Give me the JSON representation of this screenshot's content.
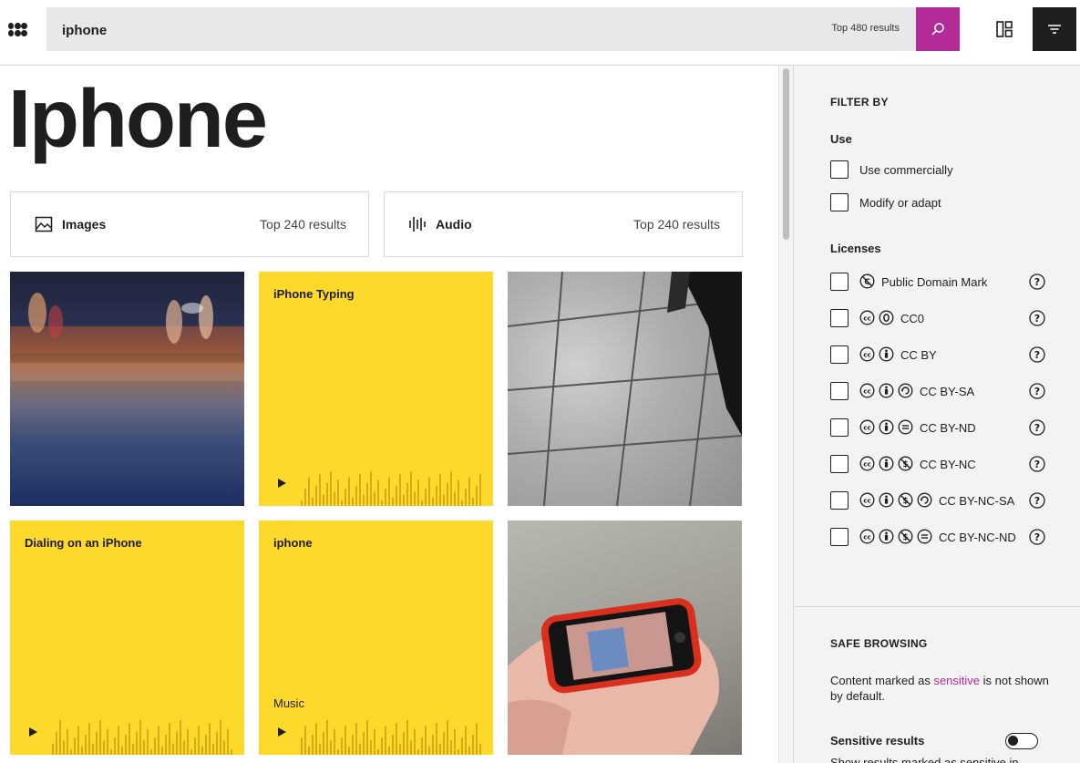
{
  "header": {
    "search_value": "iphone",
    "result_count": "Top 480 results",
    "icons": {
      "logo": "openverse-logo",
      "search": "search-icon",
      "layout": "layout-icon",
      "filter": "filter-icon"
    },
    "colors": {
      "accent": "#b42a97",
      "filter_button": "#1e1e1e"
    }
  },
  "main": {
    "title": "Iphone",
    "type_cards": [
      {
        "label": "Images",
        "count": "Top 240 results",
        "icon": "image-icon"
      },
      {
        "label": "Audio",
        "count": "Top 240 results",
        "icon": "audio-wave-icon"
      }
    ],
    "results": [
      {
        "kind": "image"
      },
      {
        "kind": "audio",
        "title": "iPhone Typing",
        "genre": ""
      },
      {
        "kind": "image"
      },
      {
        "kind": "audio",
        "title": "Dialing on an iPhone",
        "genre": ""
      },
      {
        "kind": "audio",
        "title": "iphone",
        "genre": "Music"
      },
      {
        "kind": "image"
      }
    ],
    "audio_tile_color": "#fcd92b"
  },
  "sidebar": {
    "filter_heading": "FILTER BY",
    "use": {
      "heading": "Use",
      "options": [
        "Use commercially",
        "Modify or adapt"
      ]
    },
    "licenses": {
      "heading": "Licenses",
      "items": [
        {
          "name": "Public Domain Mark",
          "icons": [
            "pdm-icon"
          ]
        },
        {
          "name": "CC0",
          "icons": [
            "cc-icon",
            "zero-icon"
          ]
        },
        {
          "name": "CC BY",
          "icons": [
            "cc-icon",
            "by-icon"
          ]
        },
        {
          "name": "CC BY-SA",
          "icons": [
            "cc-icon",
            "by-icon",
            "sa-icon"
          ]
        },
        {
          "name": "CC BY-ND",
          "icons": [
            "cc-icon",
            "by-icon",
            "nd-icon"
          ]
        },
        {
          "name": "CC BY-NC",
          "icons": [
            "cc-icon",
            "by-icon",
            "nc-icon"
          ]
        },
        {
          "name": "CC BY-NC-SA",
          "icons": [
            "cc-icon",
            "by-icon",
            "nc-icon",
            "sa-icon"
          ]
        },
        {
          "name": "CC BY-NC-ND",
          "icons": [
            "cc-icon",
            "by-icon",
            "nc-icon",
            "nd-icon"
          ]
        }
      ]
    },
    "safe_browsing": {
      "heading": "SAFE BROWSING",
      "text_before": "Content marked as ",
      "link": "sensitive",
      "text_after": " is not shown by default.",
      "toggle_label": "Sensitive results",
      "toggle_on": false,
      "cut_text": "Show results marked as sensitive in"
    }
  }
}
